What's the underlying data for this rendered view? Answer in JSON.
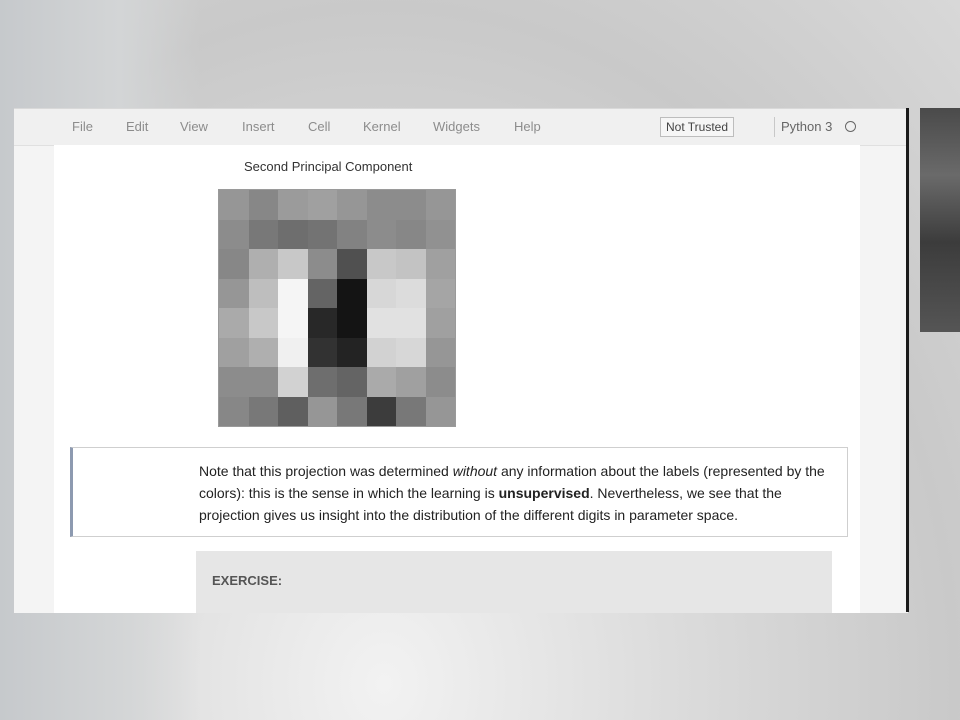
{
  "menu": {
    "items": [
      {
        "label": "File"
      },
      {
        "label": "Edit"
      },
      {
        "label": "View"
      },
      {
        "label": "Insert"
      },
      {
        "label": "Cell"
      },
      {
        "label": "Kernel"
      },
      {
        "label": "Widgets"
      },
      {
        "label": "Help"
      }
    ],
    "trusted_label": "Not Trusted",
    "kernel_name": "Python 3"
  },
  "figure": {
    "title": "Second Principal Component",
    "pixel_gray_levels": [
      [
        150,
        135,
        155,
        160,
        150,
        140,
        140,
        150
      ],
      [
        140,
        120,
        110,
        115,
        130,
        140,
        135,
        145
      ],
      [
        135,
        175,
        200,
        140,
        80,
        200,
        195,
        160
      ],
      [
        150,
        190,
        245,
        100,
        20,
        215,
        220,
        165
      ],
      [
        170,
        200,
        245,
        40,
        20,
        225,
        225,
        160
      ],
      [
        160,
        175,
        240,
        50,
        35,
        210,
        215,
        150
      ],
      [
        140,
        140,
        210,
        110,
        100,
        170,
        160,
        140
      ],
      [
        135,
        120,
        95,
        150,
        120,
        60,
        120,
        150
      ]
    ]
  },
  "markdown": {
    "p1": "Note that this projection was determined ",
    "em": "without",
    "p2": " any information about the labels (represented by the colors): this is the sense in which the learning is ",
    "strong": "unsupervised",
    "p3": ". Nevertheless, we see that the projection gives us insight into the distribution of the different digits in parameter space."
  },
  "exercise": {
    "title": "EXERCISE:"
  }
}
